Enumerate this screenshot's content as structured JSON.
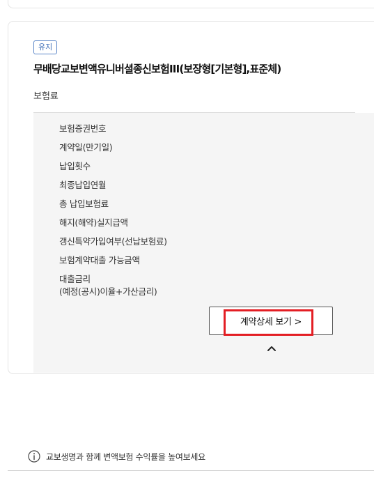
{
  "policy": {
    "status_badge": "유지",
    "product_name": "무배당교보변액유니버셜종신보험III(보장형[기본형],표준체)",
    "premium_label": "보험료",
    "details": [
      "보험증권번호",
      "계약일(만기일)",
      "납입횟수",
      "최종납입연월",
      "총 납입보험료",
      "해지(해약)실지급액",
      "갱신특약가입여부(선납보험료)",
      "보험계약대출 가능금액",
      "대출금리",
      "(예정(공시)이율+가산금리)"
    ],
    "contract_detail_button": "계약상세 보기 >"
  },
  "notice": {
    "text": "교보생명과 함께 변액보험 수익률을 높여보세요",
    "icon": "info-circle-icon"
  },
  "colors": {
    "badge_border": "#5b87c8",
    "highlight": "#e31e24",
    "panel_bg": "#f5f5f5"
  }
}
